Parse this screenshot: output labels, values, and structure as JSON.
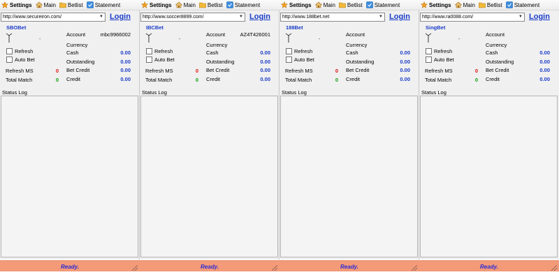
{
  "toolbar": {
    "settings_label": "Settings",
    "main_label": "Main",
    "betlist_label": "Betlist",
    "statement_label": "Statement"
  },
  "labels": {
    "login": "Login",
    "refresh": "Refresh",
    "auto_bet": "Auto Bet",
    "refresh_ms": "Refresh MS",
    "total_match": "Total Match",
    "account": "Account",
    "currency": "Currency",
    "cash": "Cash",
    "outstanding": "Outstanding",
    "bet_credit": "Bet Credit",
    "credit": "Credit",
    "status_log": "Status Log",
    "dash": "-"
  },
  "panels": [
    {
      "url": "http://www.secureiron.com/",
      "bookmaker": "SBOBet",
      "refresh_ms": "0",
      "total_match": "0",
      "account": "mbc9966002",
      "currency": "",
      "cash": "0.00",
      "outstanding": "0.00",
      "bet_credit": "0.00",
      "credit": "0.00",
      "status": "Ready."
    },
    {
      "url": "http://www.soccer8899.com/",
      "bookmaker": "IBCBet",
      "refresh_ms": "0",
      "total_match": "0",
      "account": "AZ4T426001",
      "currency": "",
      "cash": "0.00",
      "outstanding": "0.00",
      "bet_credit": "0.00",
      "credit": "0.00",
      "status": "Ready."
    },
    {
      "url": "http://www.188bet.net",
      "bookmaker": "188Bet",
      "refresh_ms": "0",
      "total_match": "0",
      "account": "",
      "currency": "",
      "cash": "0.00",
      "outstanding": "0.00",
      "bet_credit": "0.00",
      "credit": "0.00",
      "status": "Ready."
    },
    {
      "url": "http://www.ra0088.com/",
      "bookmaker": "SingBet",
      "refresh_ms": "0",
      "total_match": "0",
      "account": "",
      "currency": "",
      "cash": "0.00",
      "outstanding": "0.00",
      "bet_credit": "0.00",
      "credit": "0.00",
      "status": "Ready."
    }
  ],
  "colors": {
    "link_blue": "#1a3cc8",
    "statusbar_bg": "#f39a78",
    "ready_text": "#2b2bd8",
    "refresh_ms_value": "#e01010",
    "total_match_value": "#10a010"
  },
  "icons": {
    "settings": "star-icon",
    "main": "home-icon",
    "betlist": "folder-icon",
    "statement": "statement-icon",
    "signal": "antenna-icon",
    "dropdown": "chevron-down-icon",
    "resize": "resize-grip-icon"
  }
}
